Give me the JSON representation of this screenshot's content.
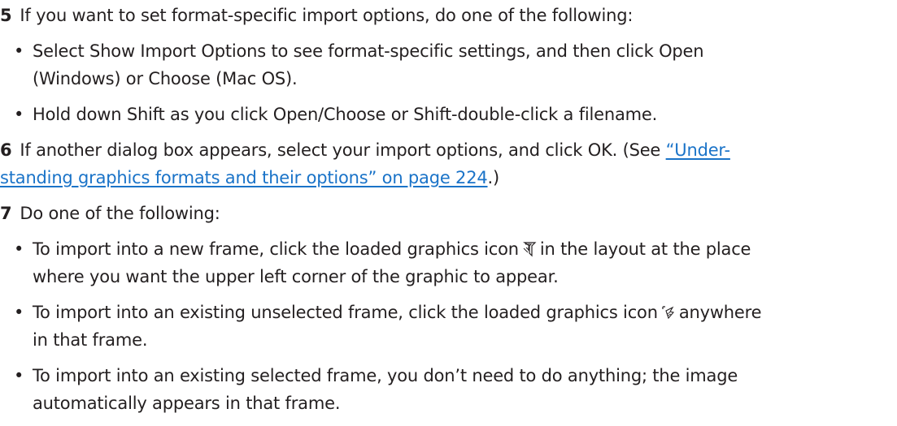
{
  "steps": {
    "s5": {
      "number": "5",
      "text": "If you want to set format-specific import options, do one of the following:",
      "bullets": [
        {
          "line1": "Select Show Import Options to see format-specific settings, and then click Open",
          "line2": "(Windows) or Choose (Mac OS)."
        },
        {
          "line1": "Hold down Shift as you click Open/Choose or Shift-double-click a filename."
        }
      ]
    },
    "s6": {
      "number": "6",
      "text_before": "If another dialog box appears, select your import options, and click OK. (See ",
      "link_line1": "“Under-",
      "link_line2": "standing graphics formats and their options” on page 224",
      "text_after": ".)"
    },
    "s7": {
      "number": "7",
      "text": "Do one of the following:",
      "bullets": [
        {
          "line1_before": "To import into a new frame, click the loaded graphics icon",
          "icon": "loaded-graphics-icon",
          "line1_after": "in the layout at the place",
          "line2": "where you want the upper left corner of the graphic to appear."
        },
        {
          "line1_before": "To import into an existing unselected frame, click the loaded graphics icon",
          "icon": "loaded-graphics-in-frame-icon",
          "line1_after": "anywhere",
          "line2": "in that frame."
        },
        {
          "line1": "To import into an existing selected frame, you don’t need to do anything; the image",
          "line2": "automatically appears in that frame."
        }
      ]
    }
  },
  "colors": {
    "text": "#231f20",
    "link": "#1a73c8"
  },
  "bullet_char": "•"
}
